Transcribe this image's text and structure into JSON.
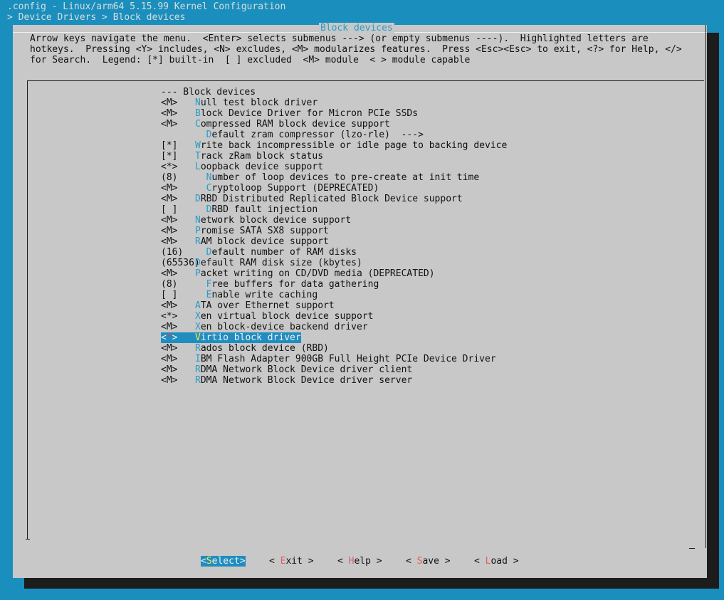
{
  "window": {
    "title": ".config - Linux/arm64 5.15.99 Kernel Configuration",
    "breadcrumb": "> Device Drivers > Block devices"
  },
  "dialog": {
    "title": "Block devices",
    "help_lines": [
      "Arrow keys navigate the menu.  <Enter> selects submenus ---> (or empty submenus ----).  Highlighted letters are",
      "hotkeys.  Pressing <Y> includes, <N> excludes, <M> modularizes features.  Press <Esc><Esc> to exit, <?> for Help, </>",
      "for Search.  Legend: [*] built-in  [ ] excluded  <M> module  < > module capable"
    ]
  },
  "menu": {
    "header": "--- Block devices",
    "selected_index": 22,
    "items": [
      {
        "mark": "<M>",
        "indent": "",
        "hotkey": "N",
        "text": "ull test block driver"
      },
      {
        "mark": "<M>",
        "indent": "",
        "hotkey": "B",
        "text": "lock Device Driver for Micron PCIe SSDs"
      },
      {
        "mark": "<M>",
        "indent": "",
        "hotkey": "C",
        "text": "ompressed RAM block device support"
      },
      {
        "mark": "",
        "indent": "  ",
        "hotkey": "D",
        "text": "efault zram compressor (lzo-rle)  --->"
      },
      {
        "mark": "[*]",
        "indent": "",
        "hotkey": "W",
        "text": "rite back incompressible or idle page to backing device"
      },
      {
        "mark": "[*]",
        "indent": "",
        "hotkey": "T",
        "text": "rack zRam block status"
      },
      {
        "mark": "<*>",
        "indent": "",
        "hotkey": "L",
        "text": "oopback device support"
      },
      {
        "mark": "(8)",
        "indent": "  ",
        "hotkey": "N",
        "text": "umber of loop devices to pre-create at init time",
        "hotkey_pos": 1
      },
      {
        "mark": "<M>",
        "indent": "  ",
        "hotkey": "C",
        "text": "ryptoloop Support (DEPRECATED)"
      },
      {
        "mark": "<M>",
        "indent": "",
        "hotkey": "D",
        "text": "RBD Distributed Replicated Block Device support"
      },
      {
        "mark": "[ ]",
        "indent": "  ",
        "hotkey": "D",
        "text": "RBD fault injection"
      },
      {
        "mark": "<M>",
        "indent": "",
        "hotkey": "N",
        "text": "etwork block device support"
      },
      {
        "mark": "<M>",
        "indent": "",
        "hotkey": "P",
        "text": "romise SATA SX8 support"
      },
      {
        "mark": "<M>",
        "indent": "",
        "hotkey": "R",
        "text": "AM block device support"
      },
      {
        "mark": "(16)",
        "indent": "  ",
        "hotkey": "D",
        "text": "efault number of RAM disks"
      },
      {
        "mark": "(65536)",
        "indent": "",
        "hotkey": "D",
        "text": "efault RAM disk size (kbytes)"
      },
      {
        "mark": "<M>",
        "indent": "",
        "hotkey": "P",
        "text": "acket writing on CD/DVD media (DEPRECATED)"
      },
      {
        "mark": "(8)",
        "indent": "  ",
        "hotkey": "F",
        "text": "ree buffers for data gathering"
      },
      {
        "mark": "[ ]",
        "indent": "  ",
        "hotkey": "E",
        "text": "nable write caching"
      },
      {
        "mark": "<M>",
        "indent": "",
        "hotkey": "A",
        "text": "TA over Ethernet support"
      },
      {
        "mark": "<*>",
        "indent": "",
        "hotkey": "X",
        "text": "en virtual block device support"
      },
      {
        "mark": "<M>",
        "indent": "",
        "hotkey": "X",
        "text": "en block-device backend driver"
      },
      {
        "mark": "<*>",
        "indent": "",
        "hotkey": "V",
        "text": "irtio block driver"
      },
      {
        "mark": "<M>",
        "indent": "",
        "hotkey": "R",
        "text": "ados block device (RBD)"
      },
      {
        "mark": "<M>",
        "indent": "",
        "hotkey": "I",
        "text": "BM Flash Adapter 900GB Full Height PCIe Device Driver"
      },
      {
        "mark": "<M>",
        "indent": "",
        "hotkey": "R",
        "text": "DMA Network Block Device driver client"
      },
      {
        "mark": "<M>",
        "indent": "",
        "hotkey": "R",
        "text": "DMA Network Block Device driver server"
      }
    ]
  },
  "buttons": [
    {
      "name": "select",
      "open": "<",
      "hotkey": "S",
      "rest": "elect",
      "close": ">",
      "active": true
    },
    {
      "name": "exit",
      "open": "< ",
      "hotkey": "E",
      "rest": "xit",
      "close": " >",
      "active": false
    },
    {
      "name": "help",
      "open": "< ",
      "hotkey": "H",
      "rest": "elp",
      "close": " >",
      "active": false
    },
    {
      "name": "save",
      "open": "< ",
      "hotkey": "S",
      "rest": "ave",
      "close": " >",
      "active": false
    },
    {
      "name": "load",
      "open": "< ",
      "hotkey": "L",
      "rest": "oad",
      "close": " >",
      "active": false
    }
  ],
  "colors": {
    "background": "#1a8fbd",
    "dialog": "#c8c8c8",
    "hotkey": "#2a9cc8",
    "selection": "#1f8dc0"
  }
}
